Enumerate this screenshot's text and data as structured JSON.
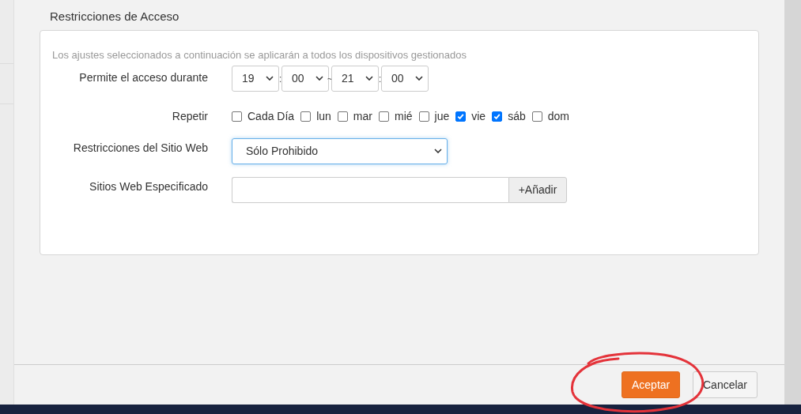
{
  "section_title": "Restricciones de Acceso",
  "hint": "Los ajustes seleccionados a continuación se aplicarán a todos los dispositivos gestionados",
  "schedule": {
    "label": "Permite el acceso durante",
    "items": [
      {
        "kind": "select",
        "value": "19"
      },
      {
        "kind": "separator",
        "text": ":"
      },
      {
        "kind": "select",
        "value": "00"
      },
      {
        "kind": "separator",
        "text": "~"
      },
      {
        "kind": "select",
        "value": "21"
      },
      {
        "kind": "separator",
        "text": ":"
      },
      {
        "kind": "select",
        "value": "00"
      }
    ]
  },
  "repeat": {
    "label": "Repetir",
    "options": [
      {
        "label": "Cada Día",
        "checked": false
      },
      {
        "label": "lun",
        "checked": false
      },
      {
        "label": "mar",
        "checked": false
      },
      {
        "label": "mié",
        "checked": false
      },
      {
        "label": "jue",
        "checked": false
      },
      {
        "label": "vie",
        "checked": true
      },
      {
        "label": "sáb",
        "checked": true
      },
      {
        "label": "dom",
        "checked": false
      }
    ]
  },
  "website_restriction": {
    "label": "Restricciones del Sitio Web",
    "value": "Sólo Prohibido"
  },
  "specified_sites": {
    "label": "Sitios Web Especificado",
    "button": "+Añadir"
  },
  "footer": {
    "buttons": [
      {
        "label": "Aceptar",
        "kind": "primary"
      },
      {
        "label": "Cancelar",
        "kind": "secondary"
      }
    ]
  }
}
